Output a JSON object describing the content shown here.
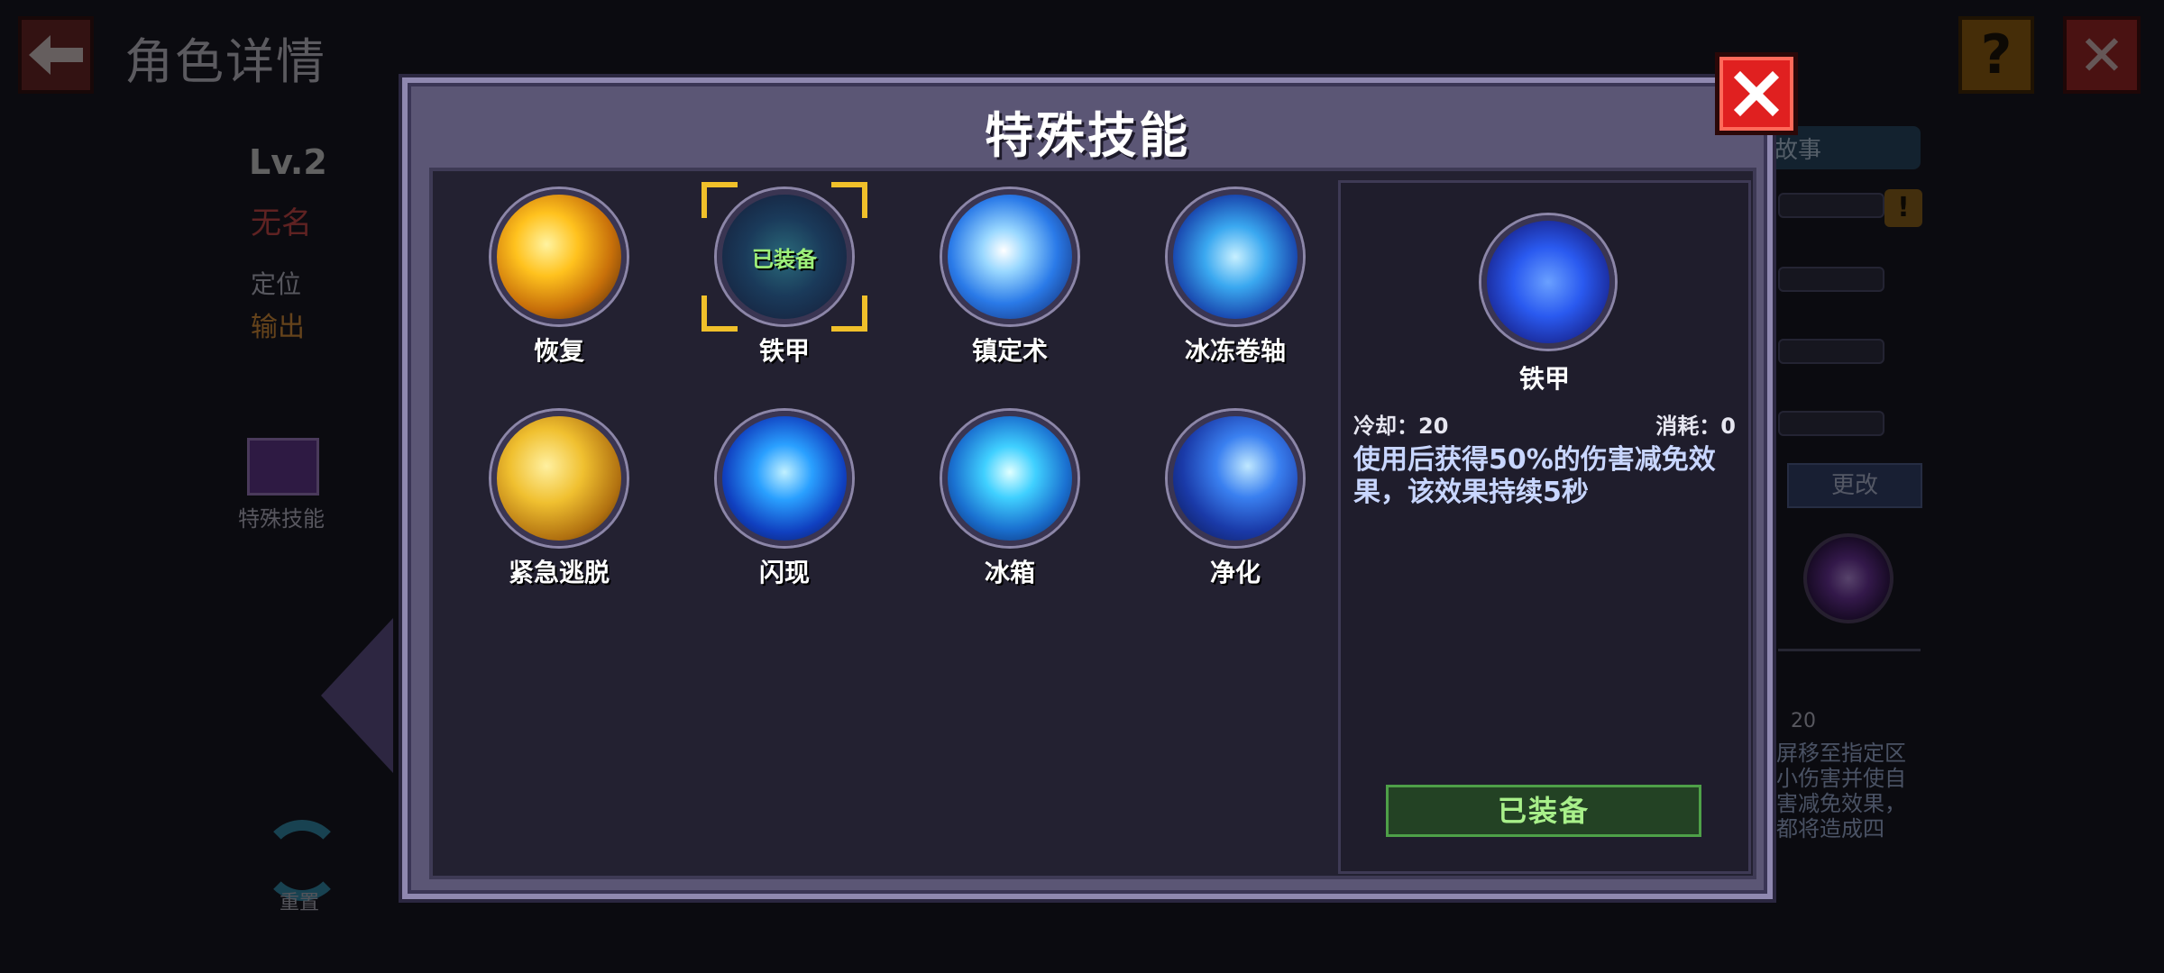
{
  "background": {
    "title": "角色详情",
    "level": "Lv.2",
    "name": "无名",
    "role_label": "定位",
    "role_value": "输出",
    "skill_slot_label": "特殊技能",
    "reset_label": "重置",
    "story_tab": "故事",
    "change_button": "更改",
    "cooldown_value": "20",
    "description_snippet": "屏移至指定区\n小伤害并使自\n害减免效果，\n都将造成四"
  },
  "modal": {
    "title": "特殊技能",
    "skills": [
      {
        "label": "恢复",
        "icon": "recover-icon",
        "equipped": false
      },
      {
        "label": "铁甲",
        "icon": "iron-armor-icon",
        "equipped": true,
        "equipped_text": "已装备"
      },
      {
        "label": "镇定术",
        "icon": "calm-scroll-icon",
        "equipped": false
      },
      {
        "label": "冰冻卷轴",
        "icon": "freeze-scroll-icon",
        "equipped": false
      },
      {
        "label": "紧急逃脱",
        "icon": "escape-icon",
        "equipped": false
      },
      {
        "label": "闪现",
        "icon": "flash-icon",
        "equipped": false
      },
      {
        "label": "冰箱",
        "icon": "ice-box-icon",
        "equipped": false
      },
      {
        "label": "净化",
        "icon": "purify-icon",
        "equipped": false
      }
    ],
    "detail": {
      "name": "铁甲",
      "cooldown": "冷却：20",
      "cost": "消耗：0",
      "description": "使用后获得50%的伤害减免效果，该效果持续5秒",
      "button": "已装备"
    }
  },
  "colors": {
    "accent_gold": "#f0c02a",
    "close_red": "#e02020",
    "equipped_green": "#a8f08a"
  }
}
